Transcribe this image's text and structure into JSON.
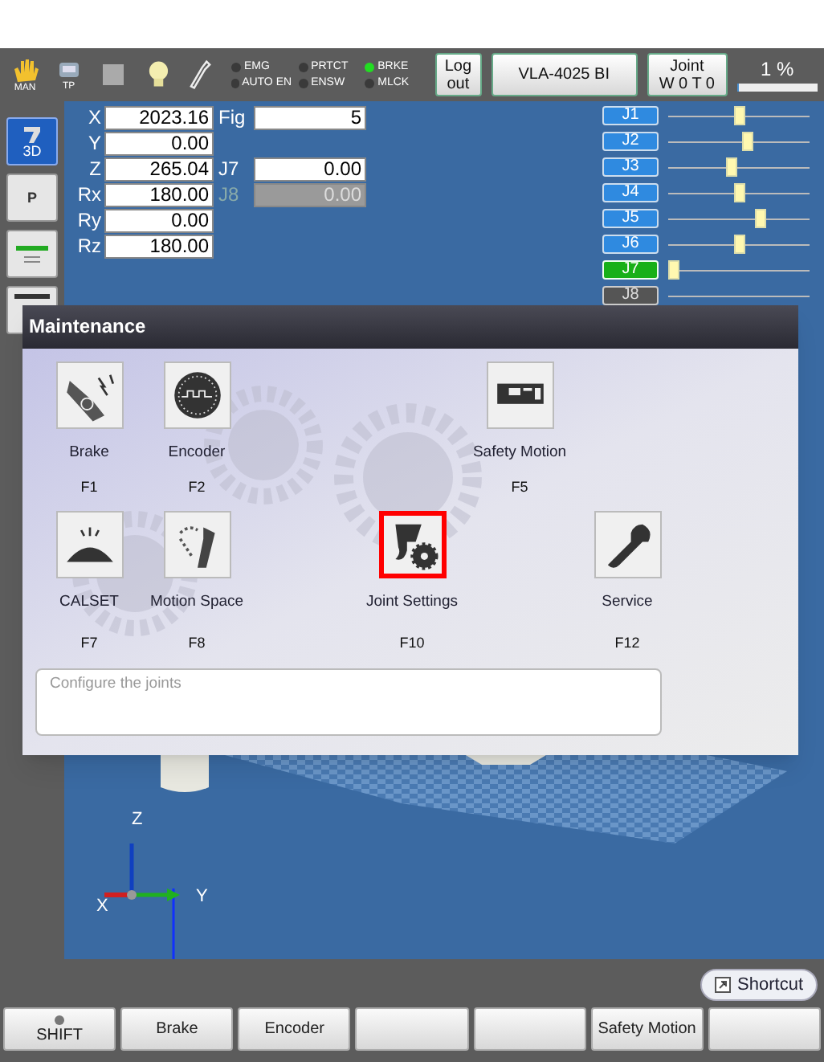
{
  "toolbar": {
    "mode_label": "MAN",
    "pendant_label": "TP",
    "indicators": [
      {
        "label": "EMG",
        "on": false
      },
      {
        "label": "PRTCT",
        "on": false
      },
      {
        "label": "BRKE",
        "on": true
      },
      {
        "label": "AUTO EN",
        "on": false
      },
      {
        "label": "ENSW",
        "on": false
      },
      {
        "label": "MLCK",
        "on": false
      }
    ],
    "logout_button": [
      "Log",
      "out"
    ],
    "robot_button": "VLA-4025 BI",
    "coord_button": [
      "Joint",
      "W 0 T 0"
    ],
    "speed": "1 %",
    "speed_level": {
      "level": 0.02
    }
  },
  "side_buttons": [
    {
      "kind": "model",
      "label": "3D",
      "selected": true
    },
    {
      "kind": "point",
      "label": "P",
      "selected": false
    },
    {
      "kind": "list",
      "selected": false
    },
    {
      "kind": "bar",
      "selected": false
    }
  ],
  "position": [
    {
      "label": "X",
      "value": "2023.16"
    },
    {
      "label": "Y",
      "value": "0.00"
    },
    {
      "label": "Z",
      "value": "265.04"
    },
    {
      "label": "Rx",
      "value": "180.00"
    },
    {
      "label": "Ry",
      "value": "0.00"
    },
    {
      "label": "Rz",
      "value": "180.00"
    }
  ],
  "extra_fields": [
    {
      "label": "Fig",
      "value": "5",
      "disabled": false
    },
    {
      "label": "J7",
      "value": "0.00",
      "disabled": false
    },
    {
      "label": "J8",
      "value": "0.00",
      "disabled": true
    }
  ],
  "joints": [
    {
      "label": "J1",
      "selected": false,
      "disabled": false,
      "level": 0.5
    },
    {
      "label": "J2",
      "selected": false,
      "disabled": false,
      "level": 0.57
    },
    {
      "label": "J3",
      "selected": false,
      "disabled": false,
      "level": 0.45
    },
    {
      "label": "J4",
      "selected": false,
      "disabled": false,
      "level": 0.5
    },
    {
      "label": "J5",
      "selected": false,
      "disabled": false,
      "level": 0.67
    },
    {
      "label": "J6",
      "selected": false,
      "disabled": false,
      "level": 0.5
    },
    {
      "label": "J7",
      "selected": true,
      "disabled": false,
      "level": 0
    },
    {
      "label": "J8",
      "selected": false,
      "disabled": true
    }
  ],
  "scene": {
    "axis_labels": [
      "Z",
      "X",
      "Y"
    ]
  },
  "dialog": {
    "title": "Maintenance",
    "rows": [
      [
        {
          "kind": "brake",
          "label": "Brake",
          "key": "F1",
          "selected": false
        },
        {
          "kind": "encoder",
          "label": "Encoder",
          "key": "F2",
          "selected": false
        },
        {
          "kind": "empty"
        },
        {
          "kind": "empty"
        },
        {
          "kind": "safety",
          "label": "Safety Motion",
          "key": "F5",
          "selected": false
        },
        {
          "kind": "empty"
        }
      ],
      [
        {
          "kind": "calset",
          "label": "CALSET",
          "key": "F7",
          "selected": false
        },
        {
          "kind": "motion",
          "label": "Motion Space",
          "key": "F8",
          "selected": false
        },
        {
          "kind": "empty"
        },
        {
          "kind": "joint",
          "label": "Joint Settings",
          "key": "F10",
          "selected": true
        },
        {
          "kind": "empty"
        },
        {
          "kind": "service",
          "label": "Service",
          "key": "F12",
          "selected": false
        }
      ]
    ],
    "description": "Configure the joints"
  },
  "shortcut_button": "Shortcut",
  "function_keys": [
    {
      "kind": "shift",
      "label": "SHIFT"
    },
    {
      "kind": "label",
      "label": "Brake"
    },
    {
      "kind": "label",
      "label": "Encoder"
    },
    {
      "kind": "blank"
    },
    {
      "kind": "blank"
    },
    {
      "kind": "label",
      "label": "Safety Motion"
    },
    {
      "kind": "blank"
    }
  ]
}
